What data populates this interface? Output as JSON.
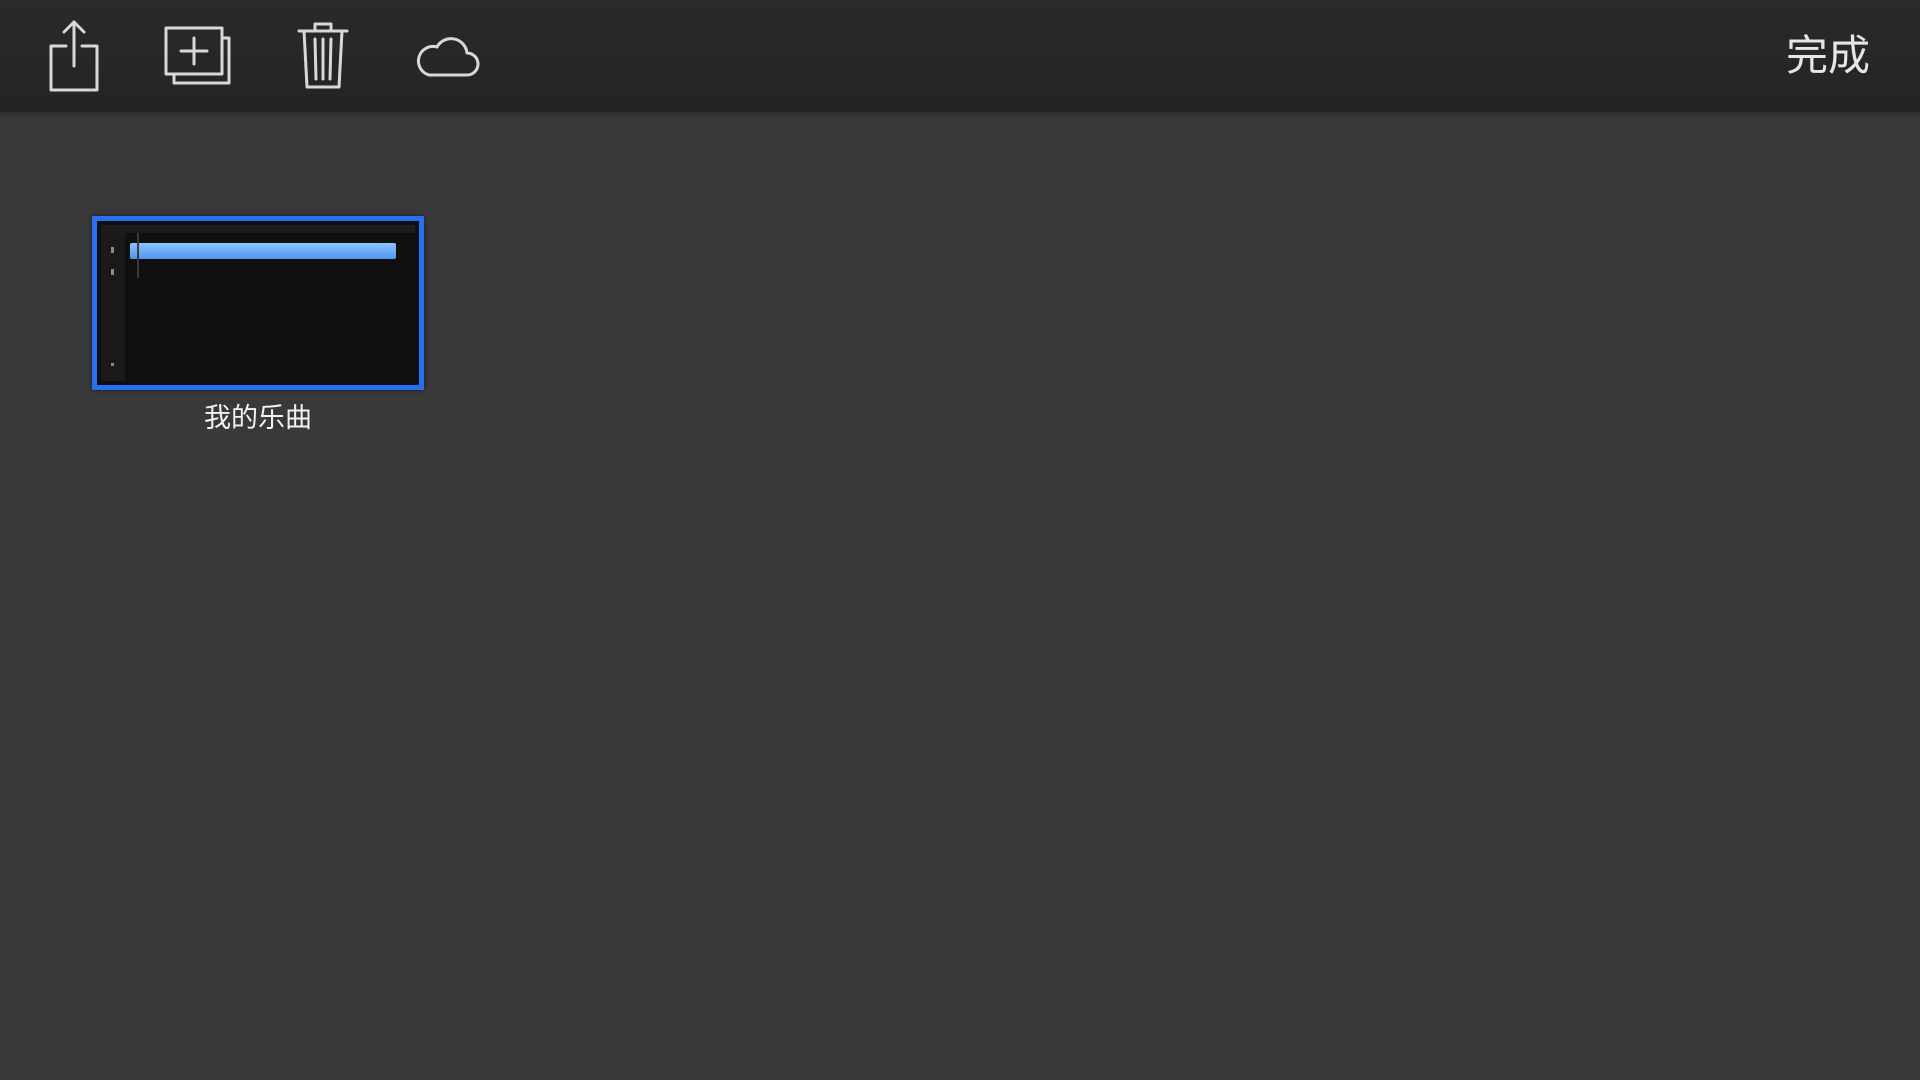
{
  "toolbar": {
    "icons": {
      "share": "share-icon",
      "duplicate": "duplicate-icon",
      "delete": "trash-icon",
      "cloud": "cloud-icon"
    },
    "done_label": "完成",
    "icon_color": "#d8d8d8"
  },
  "songs": [
    {
      "title": "我的乐曲",
      "selected": true,
      "selection_color": "#2a6ff0"
    }
  ]
}
